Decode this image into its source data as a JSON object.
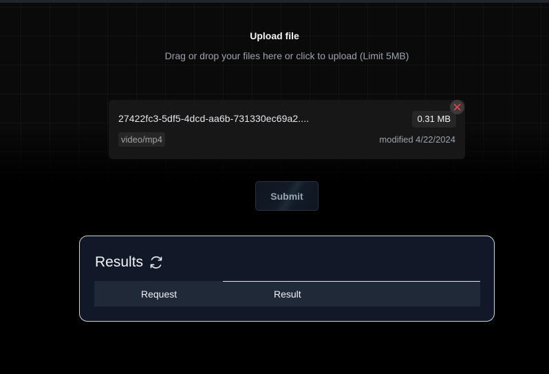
{
  "upload": {
    "title": "Upload file",
    "subtitle": "Drag or drop your files here or click to upload (Limit 5MB)"
  },
  "file": {
    "name": "27422fc3-5df5-4dcd-aa6b-731330ec69a2....",
    "size": "0.31 MB",
    "type": "video/mp4",
    "modified": "modified 4/22/2024",
    "remove_icon": "close-icon"
  },
  "actions": {
    "submit_label": "Submit"
  },
  "results": {
    "title": "Results",
    "refresh_icon": "refresh-icon",
    "columns": [
      "Request",
      "Result"
    ]
  },
  "colors": {
    "background": "#000000",
    "card": "#171717",
    "results_bg": "#111827",
    "table_header_bg": "#1f2937",
    "remove_icon": "#ef4444"
  }
}
